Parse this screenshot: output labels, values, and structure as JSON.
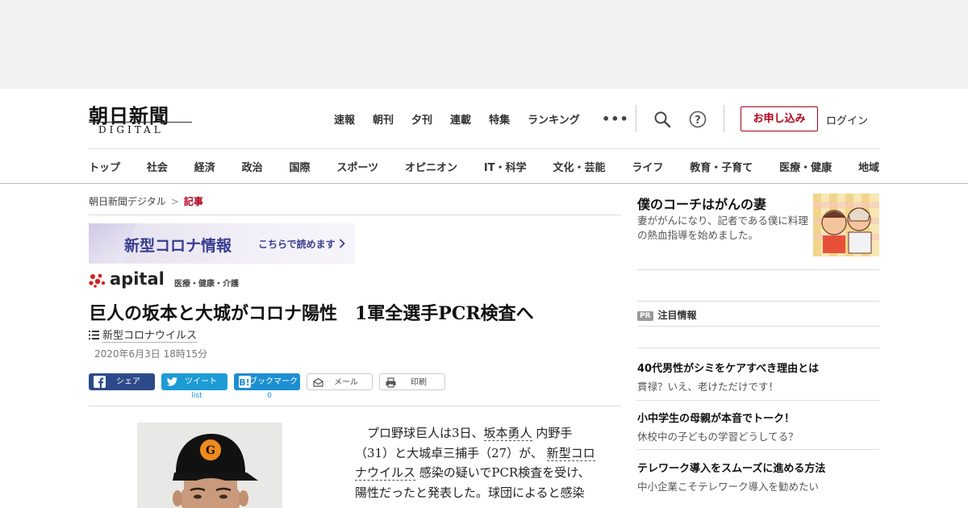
{
  "logo": {
    "kanji": "朝日新聞",
    "sub": "DIGITAL"
  },
  "topnav": [
    "速報",
    "朝刊",
    "夕刊",
    "連載",
    "特集",
    "ランキング"
  ],
  "more_label": "•••",
  "subscribe_label": "お申し込み",
  "login_label": "ログイン",
  "categories": [
    "トップ",
    "社会",
    "経済",
    "政治",
    "国際",
    "スポーツ",
    "オピニオン",
    "IT・科学",
    "文化・芸能",
    "ライフ",
    "教育・子育て",
    "医療・健康",
    "地域"
  ],
  "breadcrumb": {
    "home": "朝日新聞デジタル",
    "sep": ">",
    "current": "記事"
  },
  "corona_banner": {
    "title": "新型コロナ情報",
    "link": "こちらで読めます"
  },
  "apital": {
    "word": "apital",
    "sub": "医療・健康・介護"
  },
  "article": {
    "headline": "巨人の坂本と大城がコロナ陽性　1軍全選手PCR検査へ",
    "tag": "新型コロナウイルス",
    "date": "2020年6月3日 18時15分",
    "body_lines": [
      [
        "　プロ野球巨人は3日、",
        {
          "link": "坂本勇人"
        },
        "内野手"
      ],
      [
        "（31）と大城卓三捕手（27）が、",
        {
          "link": "新型コロ"
        }
      ],
      [
        {
          "link": "ナウイルス"
        },
        "感染の疑いでPCR検査を受け、"
      ],
      [
        "陽性だったと発表した。球団によると感染"
      ]
    ]
  },
  "share": {
    "facebook": "シェア",
    "twitter": "ツイート",
    "twitter_count": "list",
    "hatena": "ブックマーク",
    "hatena_count": "0",
    "mail": "メール",
    "print": "印刷"
  },
  "promo": {
    "title": "僕のコーチはがんの妻",
    "desc": "妻ががんになり、記者である僕に料理の熱血指導を始めました。"
  },
  "pr": {
    "badge": "PR",
    "heading": "注目情報",
    "items": [
      {
        "title": "40代男性がシミをケアすべき理由とは",
        "sub": "貫禄？いえ、老けただけです！"
      },
      {
        "title": "小中学生の母親が本音でトーク！",
        "sub": "休校中の子どもの学習どうしてる？"
      },
      {
        "title": "テレワーク導入をスムーズに進める方法",
        "sub": "中小企業こそテレワーク導入を勧めたい"
      }
    ]
  },
  "colors": {
    "brand_red": "#b1001c",
    "corona_blue": "#3a3d8f",
    "facebook": "#2d4a8a",
    "twitter": "#1d9bd5",
    "hatena": "#1d8ed1"
  }
}
